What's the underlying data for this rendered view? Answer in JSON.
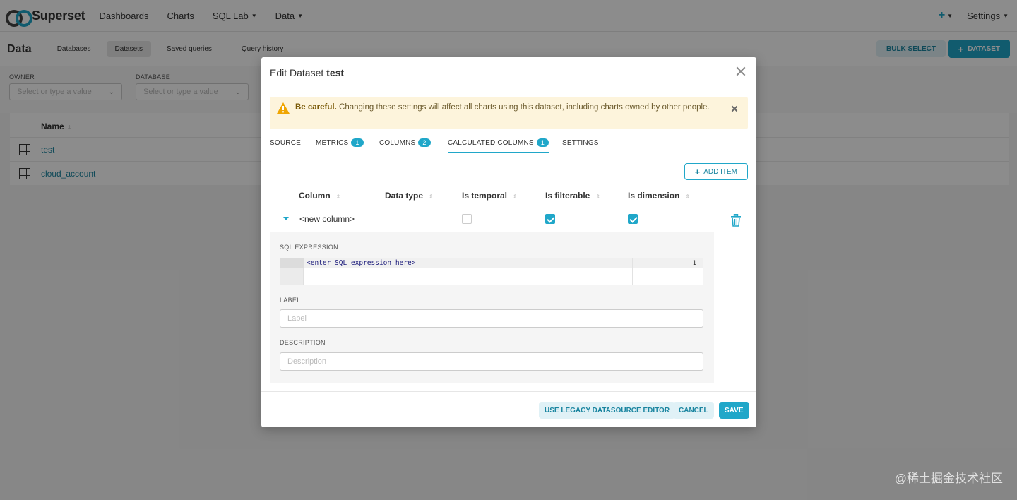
{
  "colors": {
    "accent": "#20a7c9",
    "warning": "#f0a500"
  },
  "topnav": {
    "brand": "Superset",
    "items": [
      {
        "label": "Dashboards",
        "has_caret": false
      },
      {
        "label": "Charts",
        "has_caret": false
      },
      {
        "label": "SQL Lab",
        "has_caret": true
      },
      {
        "label": "Data",
        "has_caret": true
      }
    ],
    "plus_label": "+",
    "settings_label": "Settings"
  },
  "subheader": {
    "title": "Data",
    "tabs": [
      "Databases",
      "Datasets",
      "Saved queries",
      "Query history"
    ],
    "active_tab": "Datasets",
    "bulk_select": "BULK SELECT",
    "add_dataset": "DATASET"
  },
  "filters": {
    "owner": {
      "label": "OWNER",
      "placeholder": "Select or type a value"
    },
    "database": {
      "label": "DATABASE",
      "placeholder": "Select or type a value"
    }
  },
  "table": {
    "header": "Name",
    "rows": [
      "test",
      "cloud_account"
    ]
  },
  "modal": {
    "title_prefix": "Edit Dataset",
    "title_name": "test",
    "alert": {
      "bold": "Be careful.",
      "text": "Changing these settings will affect all charts using this dataset, including charts owned by other people."
    },
    "tabs": [
      {
        "label": "SOURCE",
        "badge": null
      },
      {
        "label": "METRICS",
        "badge": "1"
      },
      {
        "label": "COLUMNS",
        "badge": "2"
      },
      {
        "label": "CALCULATED COLUMNS",
        "badge": "1"
      },
      {
        "label": "SETTINGS",
        "badge": null
      }
    ],
    "active_tab": "CALCULATED COLUMNS",
    "add_item": "ADD ITEM",
    "columns": [
      "Column",
      "Data type",
      "Is temporal",
      "Is filterable",
      "Is dimension"
    ],
    "row": {
      "column": "<new column>",
      "is_temporal": false,
      "is_filterable": true,
      "is_dimension": true
    },
    "expanded": {
      "sql_label": "SQL EXPRESSION",
      "sql_line_number": "1",
      "sql_placeholder": "<enter SQL expression here>",
      "label_label": "LABEL",
      "label_placeholder": "Label",
      "description_label": "DESCRIPTION",
      "description_placeholder": "Description"
    },
    "footer": {
      "legacy": "USE LEGACY DATASOURCE EDITOR",
      "cancel": "CANCEL",
      "save": "SAVE"
    }
  },
  "watermark": "@稀土掘金技术社区"
}
